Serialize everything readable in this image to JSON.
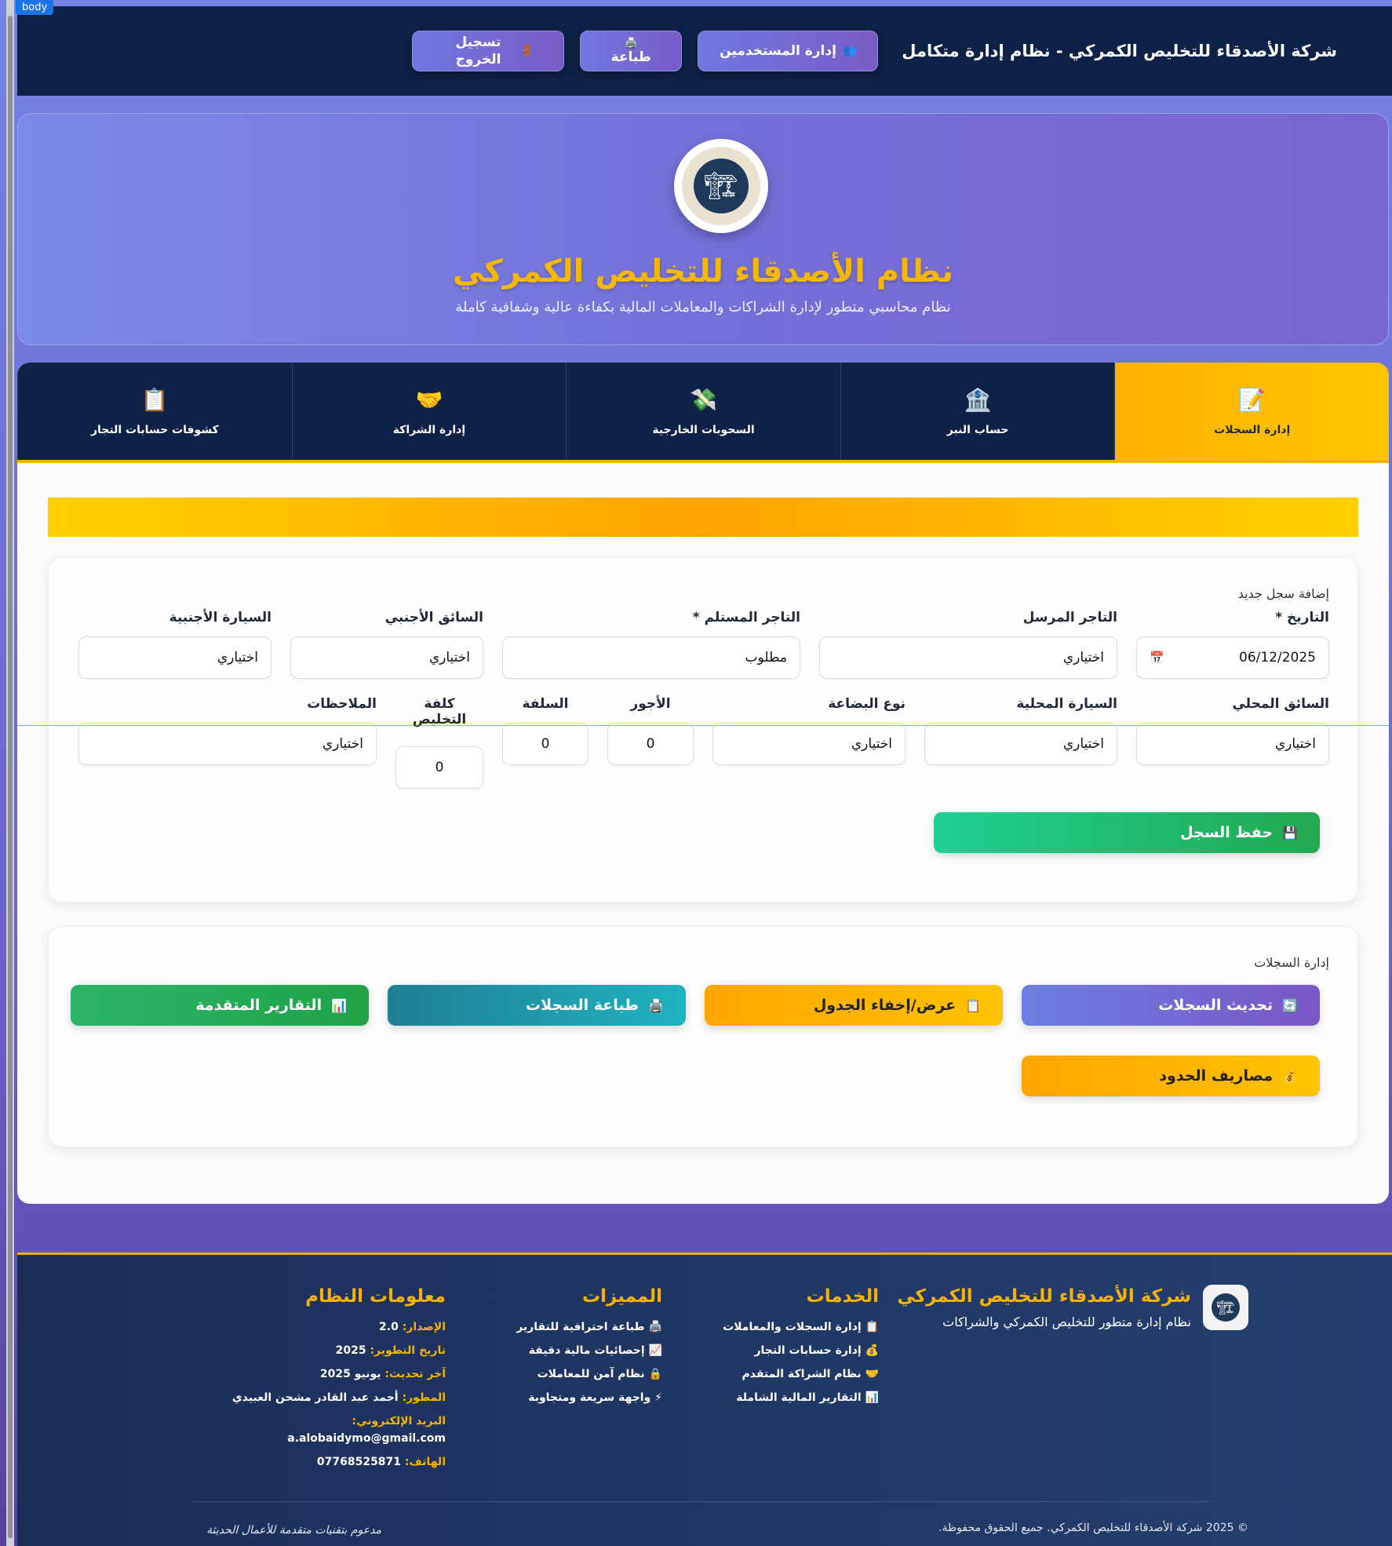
{
  "devtools": {
    "body_tag": "body"
  },
  "topbar": {
    "brand": "شركة الأصدقاء للتخليص الكمركي - نظام إدارة متكامل",
    "users_icon": "👥",
    "users_label": "إدارة المستخدمين",
    "print_icon": "🖨️",
    "print_label": "طباعة",
    "logout_icon": "🚪",
    "logout_label": "تسجيل الخروج"
  },
  "hero": {
    "logo_icon": "🏗",
    "title": "نظام الأصدقاء للتخليص الكمركي",
    "subtitle": "نظام محاسبي متطور لإدارة الشراكات والمعاملات المالية بكفاءة عالية وشفافية كاملة"
  },
  "tabs": [
    {
      "icon": "📝",
      "label": "إدارة السجلات",
      "active": true
    },
    {
      "icon": "🏦",
      "label": "حساب النبر"
    },
    {
      "icon": "💸",
      "label": "السحوبات الخارجية"
    },
    {
      "icon": "🤝",
      "label": "إدارة الشراكة"
    },
    {
      "icon": "📋",
      "label": "كشوفات حسابات التجار"
    }
  ],
  "form": {
    "title": "إضافة سجل جديد",
    "date_label": "التاريخ *",
    "date_value": "06/12/2025",
    "calendar_icon": "📅",
    "sender_label": "التاجر المرسل",
    "sender_value": "اختياري",
    "receiver_label": "التاجر المستلم *",
    "receiver_value": "مطلوب",
    "foreign_driver_label": "السائق الأجنبي",
    "foreign_driver_value": "اختياري",
    "foreign_car_label": "السيارة الأجنبية",
    "foreign_car_value": "اختياري",
    "local_driver_label": "السائق المحلي",
    "local_driver_value": "اختياري",
    "local_car_label": "السيارة المحلية",
    "local_car_value": "اختياري",
    "goods_label": "نوع البضاعة",
    "goods_value": "اختياري",
    "fees_label": "الأجور",
    "fees_value": "0",
    "advance_label": "السلفة",
    "advance_value": "0",
    "clearance_label": "كلفة التخليص",
    "clearance_value": "0",
    "notes_label": "الملاحظات",
    "notes_value": "اختياري",
    "save_icon": "💾",
    "save_label": "حفظ السجل"
  },
  "records": {
    "title": "إدارة السجلات",
    "refresh_icon": "🔄",
    "refresh_label": "تحديث السجلات",
    "toggle_icon": "📋",
    "toggle_label": "عرض/إخفاء الجدول",
    "print_icon": "🖨️",
    "print_label": "طباعة السجلات",
    "reports_icon": "📊",
    "reports_label": "التقارير المتقدمة",
    "border_icon": "💰",
    "border_label": "مصاريف الحدود"
  },
  "footer": {
    "logo_icon": "🏗",
    "company": "شركة الأصدقاء للتخليص الكمركي",
    "company_sub": "نظام إدارة متطور للتخليص الكمركي والشراكات",
    "services_title": "الخدمات",
    "services": [
      "📋 إدارة السجلات والمعاملات",
      "💰 إدارة حسابات التجار",
      "🤝 نظام الشراكة المتقدم",
      "📊 التقارير المالية الشاملة"
    ],
    "features_title": "المميزات",
    "features": [
      "🖨️ طباعة احترافية للتقارير",
      "📈 إحصائيات مالية دقيقة",
      "🔒 نظام آمن للمعاملات",
      "⚡ واجهة سريعة ومتجاوبة"
    ],
    "info_title": "معلومات النظام",
    "version_k": "الإصدار:",
    "version_v": "2.0",
    "dev_date_k": "تاريخ التطوير:",
    "dev_date_v": "2025",
    "updated_k": "آخر تحديث:",
    "updated_v": "يونيو 2025",
    "developer_k": "المطور:",
    "developer_v": "أحمد عبد القادر مشحن العبيدي",
    "email_k": "البريد الإلكتروني:",
    "email_v": "a.alobaidymo@gmail.com",
    "phone_k": "الهاتف:",
    "phone_v": "07768525871",
    "copyright": "© 2025 شركة الأصدقاء للتخليص الكمركي. جميع الحقوق محفوظة.",
    "powered": "مدعوم بتقنيات متقدمة للأعمال الحديثة"
  },
  "colors": {
    "navy": "#0e2146",
    "gold": "#f5b300",
    "purple": "#7470d8",
    "green": "#22b35e",
    "teal": "#1f9fb0"
  }
}
